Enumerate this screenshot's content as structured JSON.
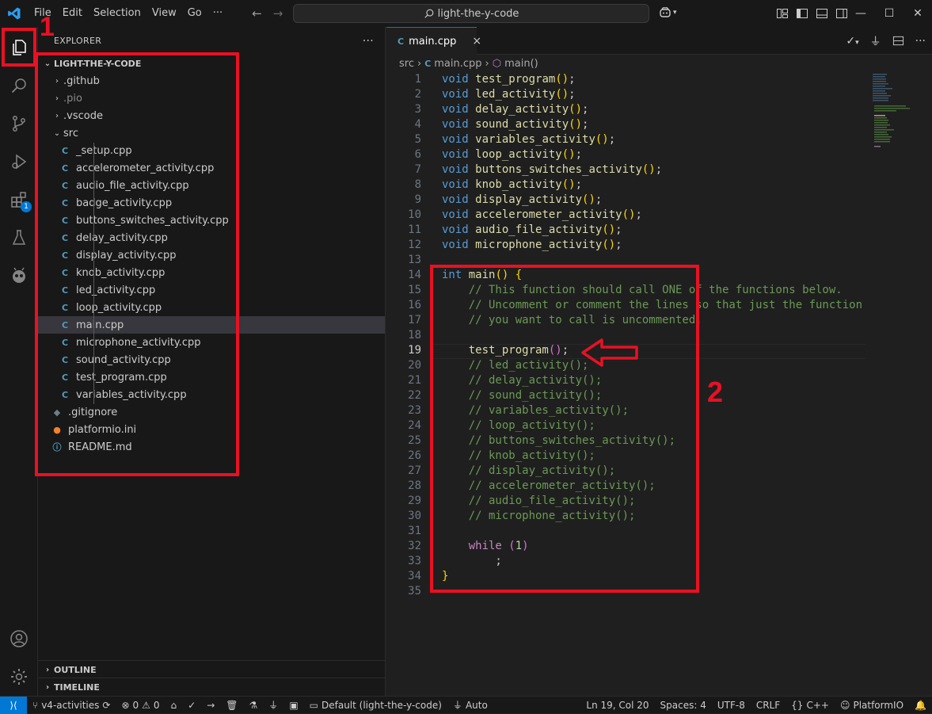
{
  "titlebar": {
    "menu": [
      "File",
      "Edit",
      "Selection",
      "View",
      "Go"
    ],
    "more": "···",
    "search": "light-the-y-code"
  },
  "activitybar": {
    "items": [
      "explorer-icon",
      "search-icon",
      "source-control-icon",
      "run-debug-icon",
      "extensions-icon",
      "testing-icon",
      "platformio-icon"
    ],
    "extensions_badge": "1",
    "bottom": [
      "account-icon",
      "settings-gear-icon"
    ]
  },
  "sidebar": {
    "title": "EXPLORER",
    "more": "···",
    "root": "LIGHT-THE-Y-CODE",
    "tree": [
      {
        "label": ".github",
        "type": "folder",
        "state": "collapsed",
        "level": 1,
        "dim": false
      },
      {
        "label": ".pio",
        "type": "folder",
        "state": "collapsed",
        "level": 1,
        "dim": true
      },
      {
        "label": ".vscode",
        "type": "folder",
        "state": "collapsed",
        "level": 1,
        "dim": false
      },
      {
        "label": "src",
        "type": "folder",
        "state": "expanded",
        "level": 1,
        "dim": false
      },
      {
        "label": "_setup.cpp",
        "type": "cpp",
        "level": 2
      },
      {
        "label": "accelerometer_activity.cpp",
        "type": "cpp",
        "level": 2
      },
      {
        "label": "audio_file_activity.cpp",
        "type": "cpp",
        "level": 2
      },
      {
        "label": "badge_activity.cpp",
        "type": "cpp",
        "level": 2
      },
      {
        "label": "buttons_switches_activity.cpp",
        "type": "cpp",
        "level": 2
      },
      {
        "label": "delay_activity.cpp",
        "type": "cpp",
        "level": 2
      },
      {
        "label": "display_activity.cpp",
        "type": "cpp",
        "level": 2
      },
      {
        "label": "knob_activity.cpp",
        "type": "cpp",
        "level": 2
      },
      {
        "label": "led_activity.cpp",
        "type": "cpp",
        "level": 2
      },
      {
        "label": "loop_activity.cpp",
        "type": "cpp",
        "level": 2
      },
      {
        "label": "main.cpp",
        "type": "cpp",
        "level": 2,
        "selected": true
      },
      {
        "label": "microphone_activity.cpp",
        "type": "cpp",
        "level": 2
      },
      {
        "label": "sound_activity.cpp",
        "type": "cpp",
        "level": 2
      },
      {
        "label": "test_program.cpp",
        "type": "cpp",
        "level": 2
      },
      {
        "label": "variables_activity.cpp",
        "type": "cpp",
        "level": 2
      },
      {
        "label": ".gitignore",
        "type": "git",
        "level": 1
      },
      {
        "label": "platformio.ini",
        "type": "pio",
        "level": 1
      },
      {
        "label": "README.md",
        "type": "info",
        "level": 1
      }
    ],
    "outline": "OUTLINE",
    "timeline": "TIMELINE"
  },
  "editor": {
    "tab": "main.cpp",
    "tab_close": "×",
    "breadcrumbs": [
      "src",
      "main.cpp",
      "main()"
    ],
    "active_line": 19,
    "lines": [
      [
        [
          "void ",
          "kw"
        ],
        [
          "test_program",
          "fn"
        ],
        [
          "()",
          "pn"
        ],
        [
          ";",
          "plain"
        ]
      ],
      [
        [
          "void ",
          "kw"
        ],
        [
          "led_activity",
          "fn"
        ],
        [
          "()",
          "pn"
        ],
        [
          ";",
          "plain"
        ]
      ],
      [
        [
          "void ",
          "kw"
        ],
        [
          "delay_activity",
          "fn"
        ],
        [
          "()",
          "pn"
        ],
        [
          ";",
          "plain"
        ]
      ],
      [
        [
          "void ",
          "kw"
        ],
        [
          "sound_activity",
          "fn"
        ],
        [
          "()",
          "pn"
        ],
        [
          ";",
          "plain"
        ]
      ],
      [
        [
          "void ",
          "kw"
        ],
        [
          "variables_activity",
          "fn"
        ],
        [
          "()",
          "pn"
        ],
        [
          ";",
          "plain"
        ]
      ],
      [
        [
          "void ",
          "kw"
        ],
        [
          "loop_activity",
          "fn"
        ],
        [
          "()",
          "pn"
        ],
        [
          ";",
          "plain"
        ]
      ],
      [
        [
          "void ",
          "kw"
        ],
        [
          "buttons_switches_activity",
          "fn"
        ],
        [
          "()",
          "pn"
        ],
        [
          ";",
          "plain"
        ]
      ],
      [
        [
          "void ",
          "kw"
        ],
        [
          "knob_activity",
          "fn"
        ],
        [
          "()",
          "pn"
        ],
        [
          ";",
          "plain"
        ]
      ],
      [
        [
          "void ",
          "kw"
        ],
        [
          "display_activity",
          "fn"
        ],
        [
          "()",
          "pn"
        ],
        [
          ";",
          "plain"
        ]
      ],
      [
        [
          "void ",
          "kw"
        ],
        [
          "accelerometer_activity",
          "fn"
        ],
        [
          "()",
          "pn"
        ],
        [
          ";",
          "plain"
        ]
      ],
      [
        [
          "void ",
          "kw"
        ],
        [
          "audio_file_activity",
          "fn"
        ],
        [
          "()",
          "pn"
        ],
        [
          ";",
          "plain"
        ]
      ],
      [
        [
          "void ",
          "kw"
        ],
        [
          "microphone_activity",
          "fn"
        ],
        [
          "()",
          "pn"
        ],
        [
          ";",
          "plain"
        ]
      ],
      [],
      [
        [
          "int ",
          "kw"
        ],
        [
          "main",
          "fn"
        ],
        [
          "() ",
          "pn"
        ],
        [
          "{",
          "pn"
        ]
      ],
      [
        [
          "    // This function should call ONE of the functions below.",
          "cm"
        ]
      ],
      [
        [
          "    // Uncomment or comment the lines so that just the function",
          "cm"
        ]
      ],
      [
        [
          "    // you want to call is uncommented.",
          "cm"
        ]
      ],
      [],
      [
        [
          "    ",
          "plain"
        ],
        [
          "test_program",
          "fn"
        ],
        [
          "()",
          "pn2"
        ],
        [
          ";",
          "plain"
        ]
      ],
      [
        [
          "    // led_activity();",
          "cm"
        ]
      ],
      [
        [
          "    // delay_activity();",
          "cm"
        ]
      ],
      [
        [
          "    // sound_activity();",
          "cm"
        ]
      ],
      [
        [
          "    // variables_activity();",
          "cm"
        ]
      ],
      [
        [
          "    // loop_activity();",
          "cm"
        ]
      ],
      [
        [
          "    // buttons_switches_activity();",
          "cm"
        ]
      ],
      [
        [
          "    // knob_activity();",
          "cm"
        ]
      ],
      [
        [
          "    // display_activity();",
          "cm"
        ]
      ],
      [
        [
          "    // accelerometer_activity();",
          "cm"
        ]
      ],
      [
        [
          "    // audio_file_activity();",
          "cm"
        ]
      ],
      [
        [
          "    // microphone_activity();",
          "cm"
        ]
      ],
      [],
      [
        [
          "    ",
          "plain"
        ],
        [
          "while ",
          "ctl"
        ],
        [
          "(",
          "pn2"
        ],
        [
          "1",
          "num"
        ],
        [
          ")",
          "pn2"
        ]
      ],
      [
        [
          "        ;",
          "plain"
        ]
      ],
      [
        [
          "}",
          "pn"
        ]
      ],
      []
    ]
  },
  "statusbar": {
    "branch": "v4-activities",
    "errors": "0",
    "warnings": "0",
    "env": "Default (light-the-y-code)",
    "auto": "Auto",
    "position": "Ln 19, Col 20",
    "spaces": "Spaces: 4",
    "encoding": "UTF-8",
    "eol": "CRLF",
    "language": "C++",
    "platformio": "PlatformIO"
  },
  "annotations": {
    "label_1": "1",
    "label_2": "2",
    "color": "#e81123"
  }
}
